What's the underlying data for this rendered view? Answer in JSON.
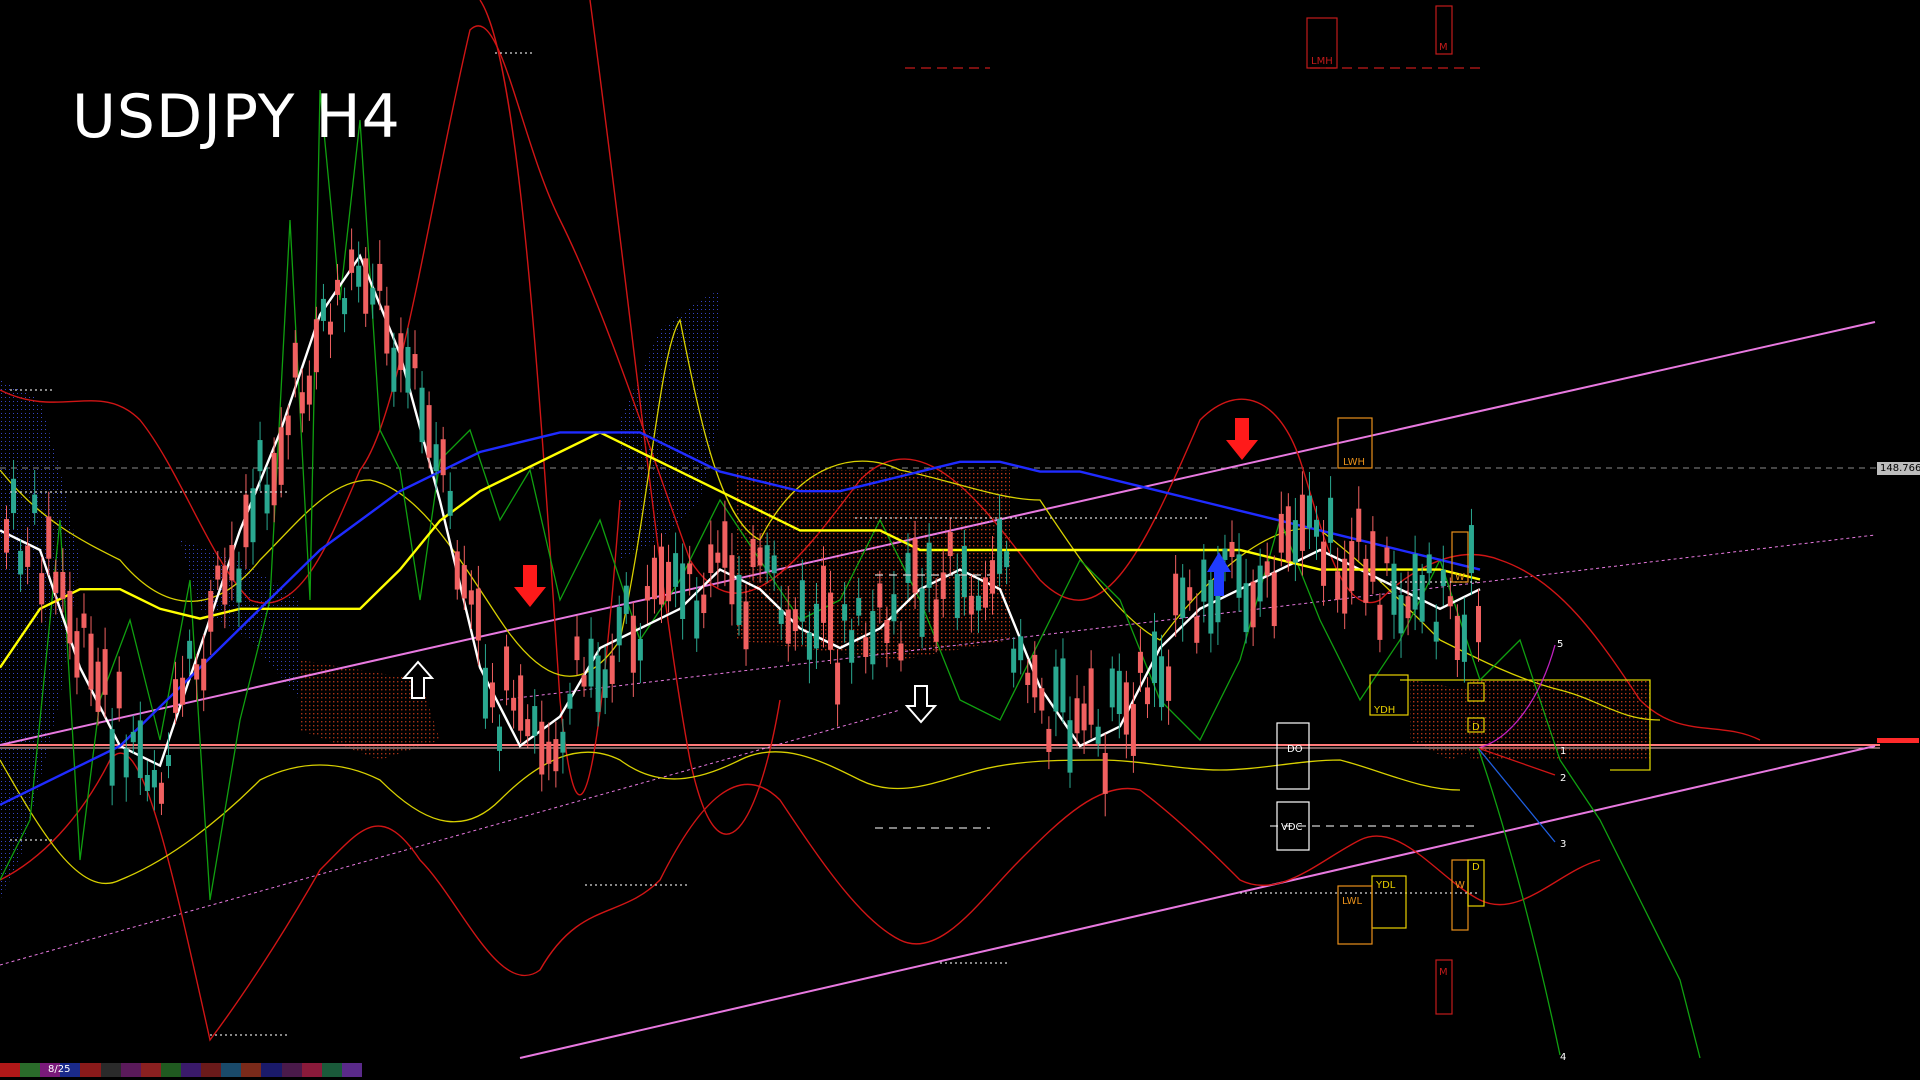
{
  "title": "USDJPY H4",
  "current_price": "148.766",
  "bottom_bar_label": "8/25",
  "chart_data": {
    "type": "line",
    "title": "USDJPY H4",
    "price_level_label": "148.766",
    "channel_level_labels": [
      "5",
      "1",
      "2",
      "3",
      "4"
    ],
    "zone_labels": [
      "LMH",
      "M",
      "LWH",
      "W",
      "YDH",
      "D",
      "DO",
      "VDC",
      "YDL",
      "LWL",
      "W",
      "D",
      "M"
    ],
    "series": [
      {
        "color": "#ffffff",
        "values": [
          0.52,
          0.5,
          0.38,
          0.3,
          0.28,
          0.4,
          0.52,
          0.62,
          0.74,
          0.8,
          0.7,
          0.55,
          0.38,
          0.3,
          0.33,
          0.4,
          0.42,
          0.44,
          0.48,
          0.46,
          0.42,
          0.4,
          0.42,
          0.46,
          0.48,
          0.46,
          0.36,
          0.3,
          0.32,
          0.4,
          0.44,
          0.46,
          0.48,
          0.5,
          0.48,
          0.46,
          0.44,
          0.46
        ]
      },
      {
        "color": "#ffff00",
        "values": [
          0.38,
          0.44,
          0.46,
          0.46,
          0.44,
          0.43,
          0.44,
          0.44,
          0.44,
          0.44,
          0.48,
          0.53,
          0.56,
          0.58,
          0.6,
          0.62,
          0.6,
          0.58,
          0.56,
          0.54,
          0.52,
          0.52,
          0.52,
          0.5,
          0.5,
          0.5,
          0.5,
          0.5,
          0.5,
          0.5,
          0.5,
          0.5,
          0.49,
          0.48,
          0.48,
          0.48,
          0.48,
          0.47
        ]
      },
      {
        "color": "#1f2bff",
        "values": [
          0.24,
          0.26,
          0.28,
          0.3,
          0.34,
          0.38,
          0.42,
          0.46,
          0.5,
          0.53,
          0.56,
          0.58,
          0.6,
          0.61,
          0.62,
          0.62,
          0.62,
          0.6,
          0.58,
          0.57,
          0.56,
          0.56,
          0.57,
          0.58,
          0.59,
          0.59,
          0.58,
          0.58,
          0.57,
          0.56,
          0.55,
          0.54,
          0.53,
          0.52,
          0.51,
          0.5,
          0.49,
          0.48
        ]
      }
    ],
    "legend": "none",
    "grid": false
  }
}
